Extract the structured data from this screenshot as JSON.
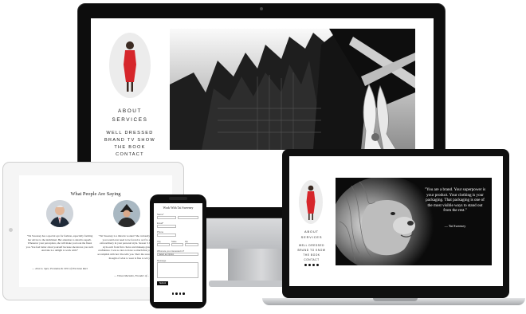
{
  "site_menu": {
    "about": "ABOUT",
    "services": "SERVICES",
    "well_dressed": "WELL DRESSED",
    "brand_tv_show": "BRAND TV SHOW",
    "the_book": "THE BOOK",
    "contact": "CONTACT",
    "laptop_brand_line1": "BRAND TO KNOW",
    "laptop_brand_line2": "THE BOOK"
  },
  "laptop_quote": {
    "text": "\"You are a brand. Your superpower is your product. Your clothing is your packaging. That packaging is one of the most visible ways to stand out from the rest.\"",
    "attribution": "— Tai Sweeney"
  },
  "tablet": {
    "heading": "What People Are Saying",
    "testimonial_left": "\"Tai Sweeney has a special eye for fashion, especially forming her advice to the individual. Her attention to detail is superb. Whenever your perception, she will make you look the finest you. You feel better about yourself because she knows you well. And she is a delight to work with!\"",
    "attribution_left": "— John G. Spec, President & CEO of Precision Reel",
    "testimonial_right": "\"Tai Sweeney is a miracle worker! She curiously fills the stage you would ever need to be forced to as if to embrace to extraordinary in your personal style. Season 3. Her ability to style each front first choice and makeup gave me great confidence. I was so nice to have so much that you're wished to accomplish with her. She tells you. She's the reason to be kind of thought of what to wear is fine to wit you.\"",
    "attribution_right": "— Vivian Marsden, Founder of..."
  },
  "phone": {
    "heading": "Work With Tai Sweeney",
    "labels": [
      "Name*",
      "Email*",
      "Phone",
      "City",
      "State",
      "Zip",
      "What are you interested in?",
      "Message"
    ],
    "select_value": "Select an Option",
    "submit_label": "Submit"
  },
  "colors": {
    "accent_red": "#d6262b",
    "bezel": "#0d0d0d",
    "aluminum": "#c4c6c9"
  },
  "icons": [
    "facebook-icon",
    "twitter-icon",
    "instagram-icon",
    "linkedin-icon"
  ]
}
